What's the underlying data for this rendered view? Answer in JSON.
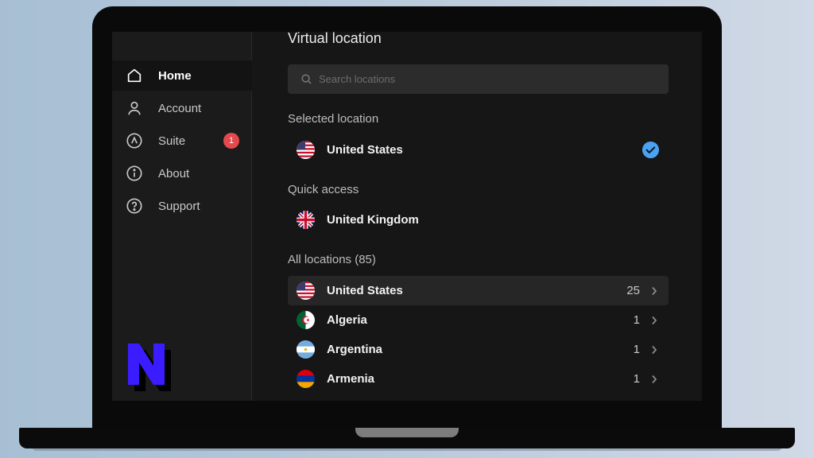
{
  "sidebar": {
    "items": [
      {
        "label": "Home",
        "icon": "home-icon",
        "active": true
      },
      {
        "label": "Account",
        "icon": "user-icon"
      },
      {
        "label": "Suite",
        "icon": "suite-icon",
        "badge": "1"
      },
      {
        "label": "About",
        "icon": "info-icon"
      },
      {
        "label": "Support",
        "icon": "help-icon"
      }
    ],
    "logo_letter": "N"
  },
  "main": {
    "title": "Virtual location",
    "search_placeholder": "Search locations",
    "selected_label": "Selected location",
    "selected": {
      "name": "United States",
      "flag": "us-flag-icon"
    },
    "quick_label": "Quick access",
    "quick": {
      "name": "United Kingdom",
      "flag": "uk-flag-icon"
    },
    "all_label": "All locations (85)",
    "locations": [
      {
        "name": "United States",
        "count": "25",
        "flag": "us-flag-icon"
      },
      {
        "name": "Algeria",
        "count": "1",
        "flag": "algeria-flag-icon"
      },
      {
        "name": "Argentina",
        "count": "1",
        "flag": "argentina-flag-icon"
      },
      {
        "name": "Armenia",
        "count": "1",
        "flag": "armenia-flag-icon"
      }
    ]
  },
  "colors": {
    "accent_check": "#4aa3f0",
    "badge": "#e5484d",
    "logo": "#3b1cff"
  }
}
